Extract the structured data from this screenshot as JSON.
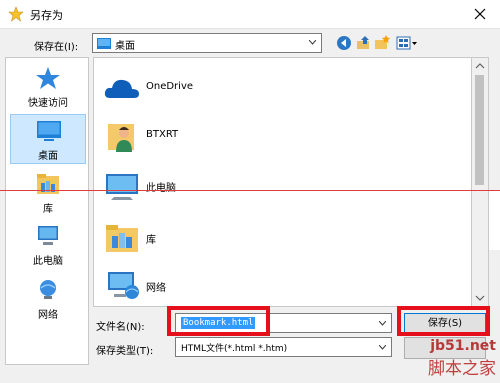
{
  "title": "另存为",
  "toolbar": {
    "lookin_label": "保存在(I):",
    "lookin_value": "桌面"
  },
  "places": [
    {
      "label": "快速访问",
      "icon": "star-icon"
    },
    {
      "label": "桌面",
      "icon": "desktop-icon",
      "selected": true
    },
    {
      "label": "库",
      "icon": "library-icon"
    },
    {
      "label": "此电脑",
      "icon": "computer-icon"
    },
    {
      "label": "网络",
      "icon": "network-icon"
    }
  ],
  "files": [
    {
      "name": "OneDrive",
      "icon": "onedrive-icon"
    },
    {
      "name": "BTXRT",
      "icon": "user-folder-icon"
    },
    {
      "name": "此电脑",
      "icon": "computer-icon"
    },
    {
      "name": "库",
      "icon": "library-icon"
    },
    {
      "name": "网络",
      "icon": "network-icon"
    }
  ],
  "bottom": {
    "filename_label": "文件名(N):",
    "filename_value": "Bookmark.html",
    "filetype_label": "保存类型(T):",
    "filetype_value": "HTML文件(*.html *.htm)",
    "save_label": "保存(S)"
  },
  "watermark": {
    "site": "jb51.net",
    "name": "脚本之家"
  },
  "colors": {
    "selection": "#3399ff",
    "accent": "#0078d7",
    "annotation": "#e5101b"
  }
}
